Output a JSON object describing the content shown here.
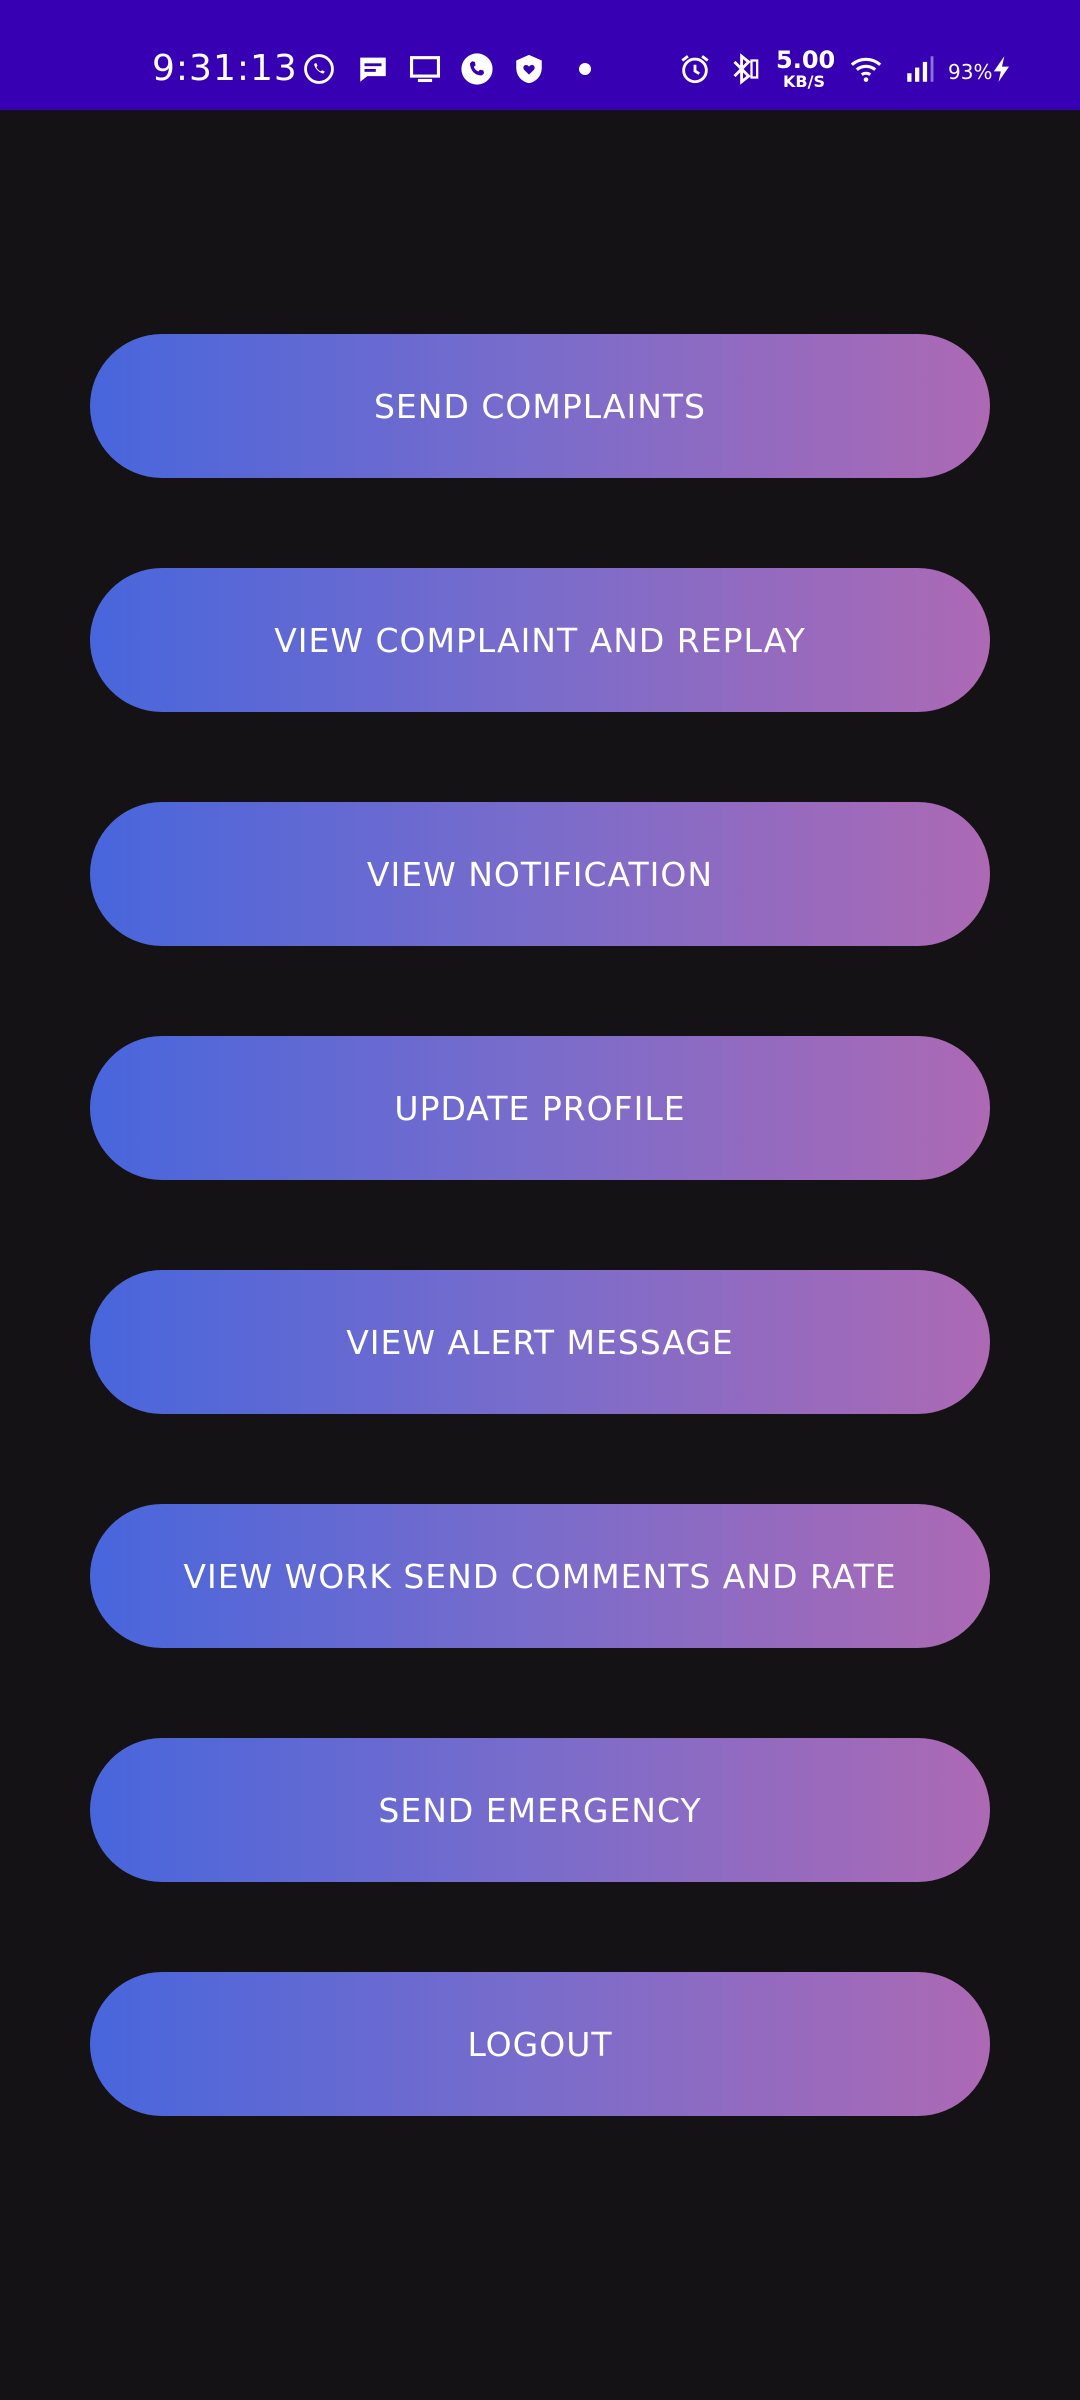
{
  "status_bar": {
    "time": "9:31:13",
    "network_speed_value": "5.00",
    "network_speed_unit": "KB/S",
    "battery_percent": "93%",
    "background_color": "#3700b3",
    "icons": [
      "whatsapp-icon",
      "message-icon",
      "screen-icon",
      "phone-icon",
      "shield-heart-icon",
      "dot-icon",
      "alarm-icon",
      "bluetooth-icon",
      "wifi-icon",
      "signal-icon",
      "charging-icon"
    ]
  },
  "menu": {
    "buttons": [
      {
        "label": "SEND COMPLAINTS"
      },
      {
        "label": "VIEW COMPLAINT AND REPLAY"
      },
      {
        "label": "VIEW NOTIFICATION"
      },
      {
        "label": "UPDATE PROFILE"
      },
      {
        "label": "VIEW ALERT MESSAGE"
      },
      {
        "label": "VIEW WORK SEND COMMENTS AND RATE"
      },
      {
        "label": "SEND EMERGENCY"
      },
      {
        "label": "LOGOUT"
      }
    ]
  },
  "colors": {
    "page_background": "#141214",
    "button_gradient_start": "#4866dc",
    "button_gradient_end": "#ad69b4",
    "button_text": "#ffffff"
  }
}
